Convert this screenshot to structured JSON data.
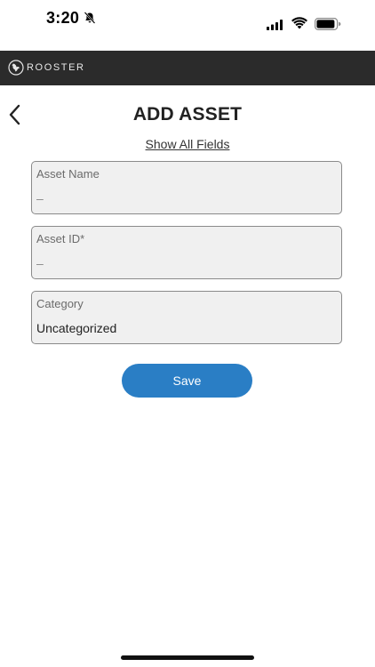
{
  "status_bar": {
    "time": "3:20",
    "icons": [
      "bell-slash-icon",
      "cellular-signal-icon",
      "wifi-icon",
      "battery-icon"
    ]
  },
  "brand": {
    "name": "ROOSTER",
    "logo_icon": "rooster-logo-icon",
    "bar_color": "#2b2b2b"
  },
  "header": {
    "title": "ADD ASSET",
    "back_icon": "chevron-left-icon"
  },
  "form": {
    "show_all_label": "Show All Fields",
    "fields": [
      {
        "label": "Asset Name",
        "value": "–"
      },
      {
        "label": "Asset ID*",
        "value": "–"
      },
      {
        "label": "Category",
        "value": "Uncategorized"
      }
    ],
    "save_label": "Save"
  },
  "colors": {
    "accent": "#2a7ec5",
    "field_background": "#f0f0f0",
    "field_border": "#8a8a8a"
  }
}
